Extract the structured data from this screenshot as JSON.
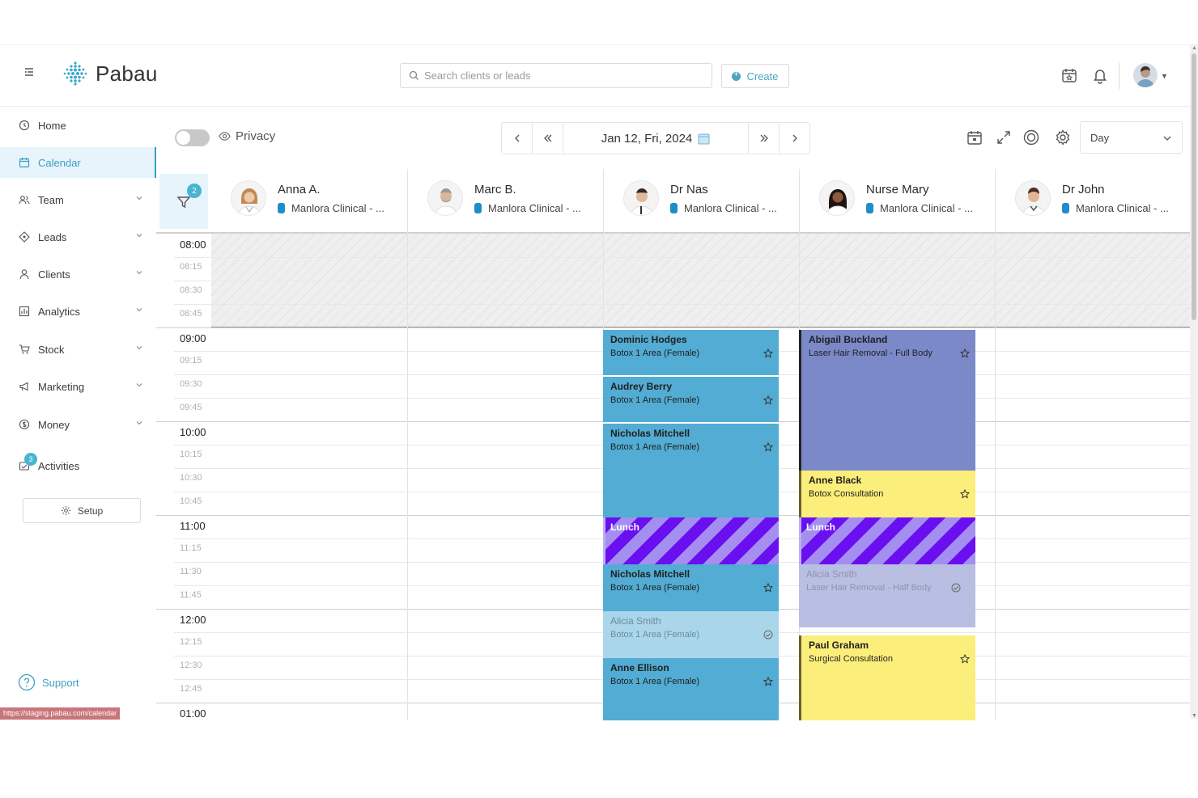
{
  "app": {
    "logo_text": "Pabau",
    "search_placeholder": "Search clients or leads",
    "create_label": "Create",
    "status_url": "https://staging.pabau.com/calendar"
  },
  "colors": {
    "accent": "#3a9fc2",
    "appointment_blue": "#52acd3",
    "appointment_purple": "#7b89c9",
    "appointment_yellow": "#fbee7a",
    "lunch_purple": "#6a10f0"
  },
  "sidebar": {
    "items": [
      {
        "label": "Home",
        "icon": "clock-icon",
        "active": false,
        "expandable": false
      },
      {
        "label": "Calendar",
        "icon": "calendar-icon",
        "active": true,
        "expandable": false
      },
      {
        "label": "Team",
        "icon": "team-icon",
        "active": false,
        "expandable": true
      },
      {
        "label": "Leads",
        "icon": "leads-icon",
        "active": false,
        "expandable": true
      },
      {
        "label": "Clients",
        "icon": "user-icon",
        "active": false,
        "expandable": true
      },
      {
        "label": "Analytics",
        "icon": "analytics-icon",
        "active": false,
        "expandable": true
      },
      {
        "label": "Stock",
        "icon": "cart-icon",
        "active": false,
        "expandable": true
      },
      {
        "label": "Marketing",
        "icon": "megaphone-icon",
        "active": false,
        "expandable": true
      },
      {
        "label": "Money",
        "icon": "money-icon",
        "active": false,
        "expandable": true
      }
    ],
    "activities": {
      "label": "Activities",
      "badge": "3"
    },
    "setup_label": "Setup",
    "support_label": "Support"
  },
  "toolbar": {
    "privacy_label": "Privacy",
    "privacy_on": false,
    "date_label": "Jan 12, Fri, 2024",
    "view_mode": "Day",
    "filter_badge": "2"
  },
  "staff": [
    {
      "name": "Anna A.",
      "location": "Manlora Clinical - ..."
    },
    {
      "name": "Marc B.",
      "location": "Manlora Clinical - ..."
    },
    {
      "name": "Dr Nas",
      "location": "Manlora Clinical - ..."
    },
    {
      "name": "Nurse Mary",
      "location": "Manlora Clinical - ..."
    },
    {
      "name": "Dr John",
      "location": "Manlora Clinical - ..."
    }
  ],
  "times": [
    "08:00",
    "08:15",
    "08:30",
    "08:45",
    "09:00",
    "09:15",
    "09:30",
    "09:45",
    "10:00",
    "10:15",
    "10:30",
    "10:45",
    "11:00",
    "11:15",
    "11:30",
    "11:45",
    "12:00",
    "12:15",
    "12:30",
    "12:45",
    "01:00"
  ],
  "appointments": {
    "dr_nas": [
      {
        "client": "Dominic Hodges",
        "service": "Botox 1 Area (Female)"
      },
      {
        "client": "Audrey Berry",
        "service": "Botox 1 Area (Female)"
      },
      {
        "client": "Nicholas Mitchell",
        "service": "Botox 1 Area (Female)"
      },
      {
        "client": "Nicholas Mitchell",
        "service": "Botox 1 Area (Female)"
      },
      {
        "client": "Alicia Smith",
        "service": "Botox 1 Area (Female)"
      },
      {
        "client": "Anne Ellison",
        "service": "Botox 1 Area (Female)"
      }
    ],
    "nurse_mary": [
      {
        "client": "Abigail Buckland",
        "service": "Laser Hair Removal - Full Body"
      },
      {
        "client": "Anne Black",
        "service": "Botox Consultation"
      },
      {
        "client": "Alicia Smith",
        "service": "Laser Hair Removal - Half Body"
      },
      {
        "client": "Paul Graham",
        "service": "Surgical Consultation"
      }
    ],
    "lunch_label": "Lunch"
  }
}
